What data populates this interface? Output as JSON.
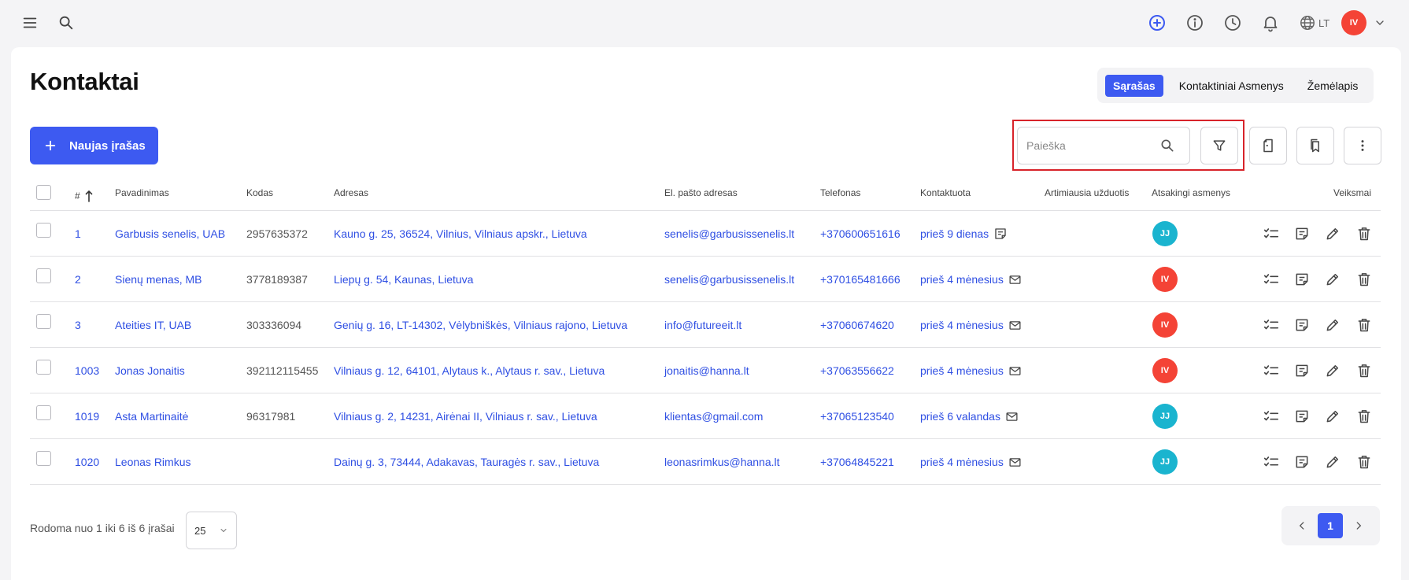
{
  "topbar": {
    "icons": [
      "menu-icon",
      "search-icon",
      "plus-circle-icon",
      "info-icon",
      "clock-icon",
      "bell-icon",
      "globe-icon"
    ],
    "language": "LT",
    "user_initials": "IV"
  },
  "page": {
    "title": "Kontaktai",
    "view_tabs": [
      "Sąrašas",
      "Kontaktiniai Asmenys",
      "Žemėlapis"
    ],
    "active_view": "Sąrašas"
  },
  "toolbar": {
    "new_label": "Naujas įrašas",
    "search_placeholder": "Paieška"
  },
  "table": {
    "columns": {
      "id": "#",
      "name": "Pavadinimas",
      "code": "Kodas",
      "address": "Adresas",
      "email": "El. pašto adresas",
      "phone": "Telefonas",
      "contacted": "Kontaktuota",
      "nearest_task": "Artimiausia užduotis",
      "responsible": "Atsakingi asmenys",
      "actions": "Veiksmai"
    },
    "rows": [
      {
        "id": "1",
        "name": "Garbusis senelis, UAB",
        "code": "2957635372",
        "address": "Kauno g. 25, 36524, Vilnius, Vilniaus apskr., Lietuva",
        "email": "senelis@garbusissenelis.lt",
        "phone": "+370600651616",
        "contacted": "prieš 9 dienas",
        "contact_icon": "note-icon",
        "responsible": "JJ",
        "responsible_color": "#1ab4cf"
      },
      {
        "id": "2",
        "name": "Sienų menas, MB",
        "code": "3778189387",
        "address": "Liepų g. 54, Kaunas, Lietuva",
        "email": "senelis@garbusissenelis.lt",
        "phone": "+370165481666",
        "contacted": "prieš 4 mėnesius",
        "contact_icon": "mail-icon",
        "responsible": "IV",
        "responsible_color": "#f44336"
      },
      {
        "id": "3",
        "name": "Ateities IT, UAB",
        "code": "303336094",
        "address": "Genių g. 16, LT-14302, Vėlybniškės, Vilniaus rajono, Lietuva",
        "email": "info@futureeit.lt",
        "phone": "+37060674620",
        "contacted": "prieš 4 mėnesius",
        "contact_icon": "mail-icon",
        "responsible": "IV",
        "responsible_color": "#f44336"
      },
      {
        "id": "1003",
        "name": "Jonas Jonaitis",
        "code": "392112115455",
        "address": "Vilniaus g. 12, 64101, Alytaus k., Alytaus r. sav., Lietuva",
        "email": "jonaitis@hanna.lt",
        "phone": "+37063556622",
        "contacted": "prieš 4 mėnesius",
        "contact_icon": "mail-icon",
        "responsible": "IV",
        "responsible_color": "#f44336"
      },
      {
        "id": "1019",
        "name": "Asta Martinaitė",
        "code": "96317981",
        "address": "Vilniaus g. 2, 14231, Airėnai II, Vilniaus r. sav., Lietuva",
        "email": "klientas@gmail.com",
        "phone": "+37065123540",
        "contacted": "prieš 6 valandas",
        "contact_icon": "mail-icon",
        "responsible": "JJ",
        "responsible_color": "#1ab4cf"
      },
      {
        "id": "1020",
        "name": "Leonas Rimkus",
        "code": "",
        "address": "Dainų g. 3, 73444, Adakavas, Tauragės r. sav., Lietuva",
        "email": "leonasrimkus@hanna.lt",
        "phone": "+37064845221",
        "contacted": "prieš 4 mėnesius",
        "contact_icon": "mail-icon",
        "responsible": "JJ",
        "responsible_color": "#1ab4cf"
      }
    ]
  },
  "footer": {
    "summary": "Rodoma nuo 1 iki 6 iš 6 įrašai",
    "per_page": "25",
    "current_page": "1"
  },
  "colors": {
    "accent": "#3d5af1",
    "link": "#2f4fe3",
    "avatar_iv": "#f44336",
    "avatar_jj": "#1ab4cf",
    "highlight": "#d8232a"
  }
}
